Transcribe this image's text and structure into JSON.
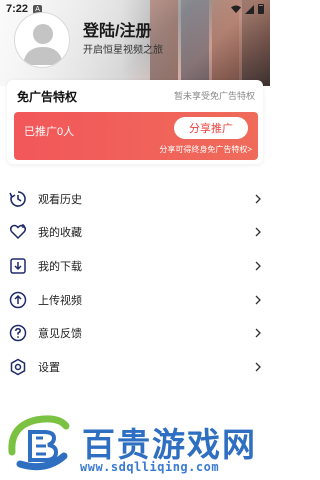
{
  "status_bar": {
    "time": "7:22",
    "app_badge": "A"
  },
  "profile": {
    "login_title": "登陆/注册",
    "login_subtitle": "开启恒星视频之旅"
  },
  "ad_free_card": {
    "title": "免广告特权",
    "status": "暂未享受免广告特权",
    "promoted_count": "已推广0人",
    "share_button_label": "分享推广",
    "hint": "分享可得终身免广告特权>"
  },
  "menu": {
    "items": [
      {
        "label": "观看历史",
        "icon": "history-icon"
      },
      {
        "label": "我的收藏",
        "icon": "favorite-heart-icon"
      },
      {
        "label": "我的下载",
        "icon": "download-icon"
      },
      {
        "label": "上传视频",
        "icon": "upload-icon"
      },
      {
        "label": "意见反馈",
        "icon": "feedback-question-icon"
      },
      {
        "label": "设置",
        "icon": "settings-hexagon-icon"
      }
    ]
  },
  "watermark": {
    "title": "百贵游戏网",
    "url": "www.sdqlliqing.com"
  },
  "colors": {
    "accent_red": "#f2575a",
    "icon_navy": "#1f2a6b",
    "watermark_blue": "#2f6fc2"
  }
}
